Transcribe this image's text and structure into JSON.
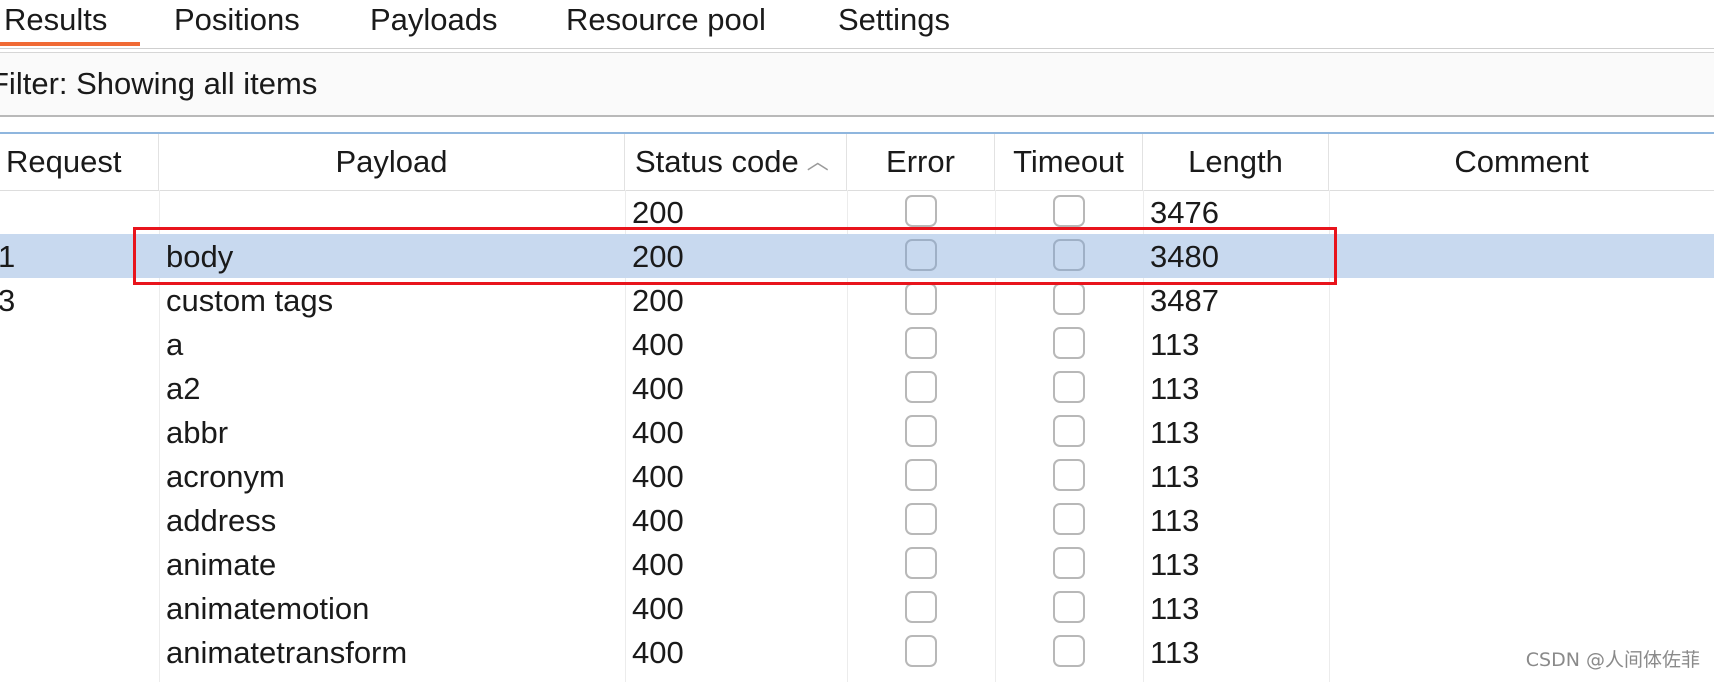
{
  "tabs": [
    {
      "label": "Results",
      "active": true
    },
    {
      "label": "Positions",
      "active": false
    },
    {
      "label": "Payloads",
      "active": false
    },
    {
      "label": "Resource pool",
      "active": false
    },
    {
      "label": "Settings",
      "active": false
    }
  ],
  "filter": {
    "text": "Filter: Showing all items"
  },
  "table": {
    "columns": [
      "Request",
      "Payload",
      "Status code",
      "Error",
      "Timeout",
      "Length",
      "Comment"
    ],
    "sort": {
      "column": "Status code",
      "icon": "chevron-up-icon"
    },
    "rows": [
      {
        "request": "",
        "payload": "",
        "status": "200",
        "error": false,
        "timeout": false,
        "length": "3476",
        "comment": "",
        "selected": false
      },
      {
        "request": "1",
        "payload": "body",
        "status": "200",
        "error": false,
        "timeout": false,
        "length": "3480",
        "comment": "",
        "selected": true
      },
      {
        "request": "3",
        "payload": "custom tags",
        "status": "200",
        "error": false,
        "timeout": false,
        "length": "3487",
        "comment": "",
        "selected": false
      },
      {
        "request": "",
        "payload": "a",
        "status": "400",
        "error": false,
        "timeout": false,
        "length": "113",
        "comment": "",
        "selected": false
      },
      {
        "request": "",
        "payload": "a2",
        "status": "400",
        "error": false,
        "timeout": false,
        "length": "113",
        "comment": "",
        "selected": false
      },
      {
        "request": "",
        "payload": "abbr",
        "status": "400",
        "error": false,
        "timeout": false,
        "length": "113",
        "comment": "",
        "selected": false
      },
      {
        "request": "",
        "payload": "acronym",
        "status": "400",
        "error": false,
        "timeout": false,
        "length": "113",
        "comment": "",
        "selected": false
      },
      {
        "request": "",
        "payload": "address",
        "status": "400",
        "error": false,
        "timeout": false,
        "length": "113",
        "comment": "",
        "selected": false
      },
      {
        "request": "",
        "payload": "animate",
        "status": "400",
        "error": false,
        "timeout": false,
        "length": "113",
        "comment": "",
        "selected": false
      },
      {
        "request": "",
        "payload": "animatemotion",
        "status": "400",
        "error": false,
        "timeout": false,
        "length": "113",
        "comment": "",
        "selected": false
      },
      {
        "request": "",
        "payload": "animatetransform",
        "status": "400",
        "error": false,
        "timeout": false,
        "length": "113",
        "comment": "",
        "selected": false
      }
    ]
  },
  "colors": {
    "active_tab_underline": "#f06a35",
    "selected_row": "#c8d9ef",
    "highlight_box": "#e8141c"
  },
  "watermark": "CSDN @人间体佐菲"
}
